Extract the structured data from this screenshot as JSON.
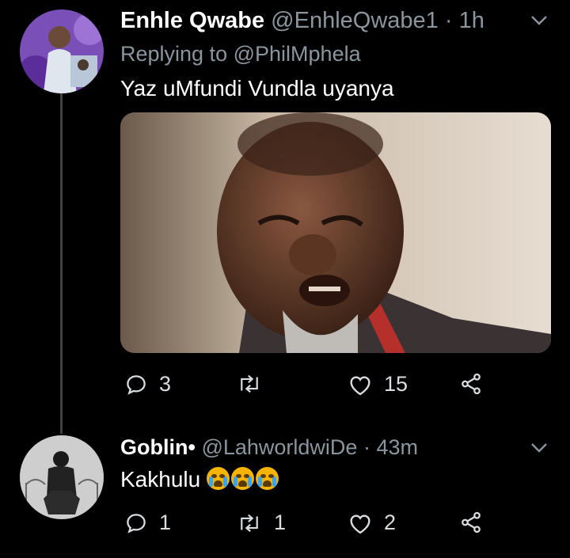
{
  "tweet1": {
    "display_name": "Enhle Qwabe",
    "handle": "@EnhleQwabe1",
    "separator": "·",
    "time": "1h",
    "replying_prefix": "Replying to",
    "replying_to": "@PhilMphela",
    "text": "Yaz uMfundi Vundla uyanya",
    "reply_count": "3",
    "retweet_count": "",
    "like_count": "15"
  },
  "tweet2": {
    "display_name": "Goblin•",
    "handle": "@LahworldwiDe",
    "separator": "·",
    "time": "43m",
    "text": "Kakhulu",
    "emoji_count": 3,
    "reply_count": "1",
    "retweet_count": "1",
    "like_count": "2"
  },
  "icons": {
    "reply": "reply-icon",
    "retweet": "retweet-icon",
    "like": "heart-icon",
    "share": "share-icon",
    "more": "chevron-down-icon"
  },
  "colors": {
    "background": "#000000",
    "muted_text": "#8b959e",
    "thread_line": "#3d4145"
  }
}
